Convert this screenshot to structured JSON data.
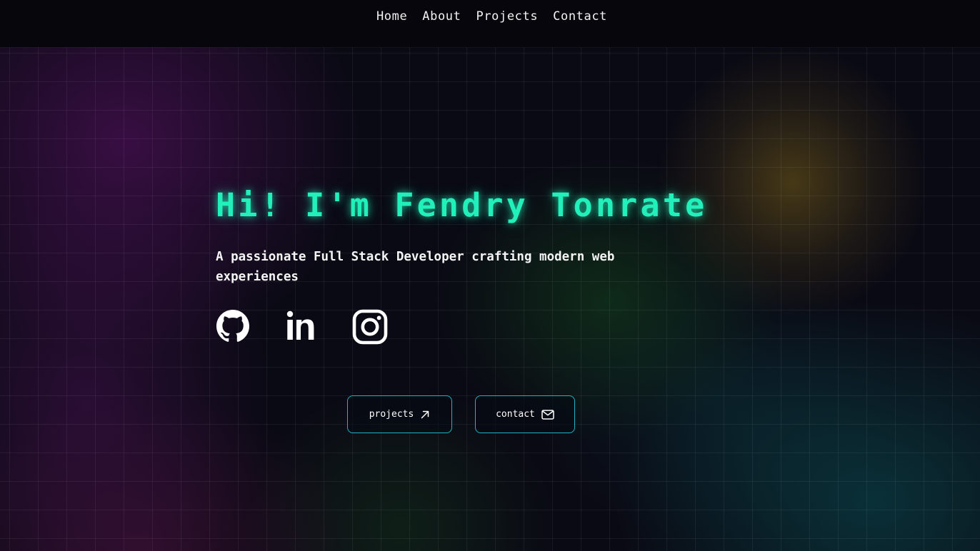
{
  "nav": {
    "links": [
      {
        "label": "Home"
      },
      {
        "label": "About"
      },
      {
        "label": "Projects"
      },
      {
        "label": "Contact"
      }
    ]
  },
  "hero": {
    "title": "Hi! I'm Fendry Tonrate",
    "subtitle": "A passionate Full Stack Developer crafting modern web experiences",
    "socials": [
      {
        "icon": "github-icon"
      },
      {
        "icon": "linkedin-icon"
      },
      {
        "icon": "instagram-icon"
      }
    ]
  },
  "buttons": {
    "projects_label": "projects",
    "projects_icon": "arrow-up-right-icon",
    "contact_label": "contact",
    "contact_icon": "mail-icon"
  },
  "colors": {
    "accent": "#22f0ba",
    "button_border": "#20b4c8",
    "nav_background": "#07060c",
    "page_background": "#0a0a14"
  }
}
